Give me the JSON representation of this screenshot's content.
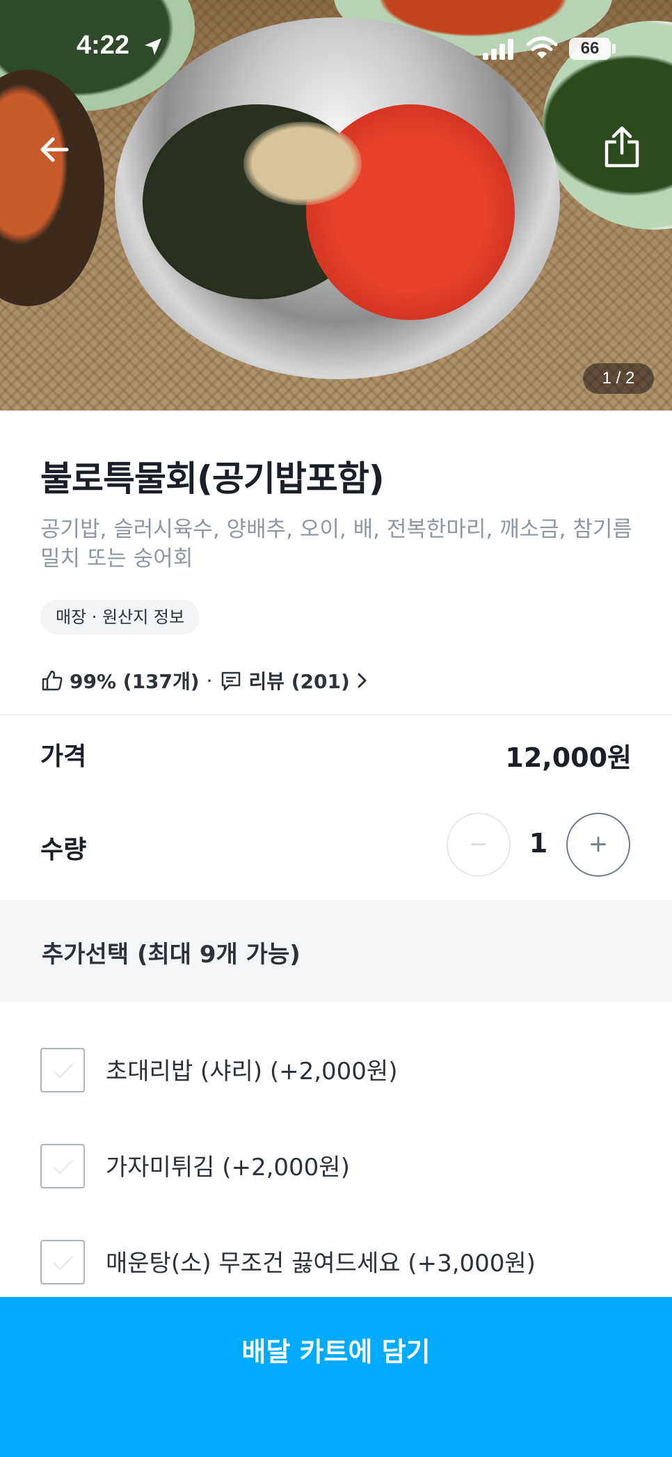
{
  "status_bar": {
    "time": "4:22",
    "battery": "66"
  },
  "hero": {
    "page_indicator": "1 / 2"
  },
  "product": {
    "title": "불로특물회(공기밥포함)",
    "description": "공기밥, 슬러시육수, 양배추, 오이, 배, 전복한마리, 깨소금, 참기름 밀치 또는 숭어회",
    "origin_chip": "매장 · 원산지 정보",
    "rating_text": "99% (137개)",
    "rating_separator": "·",
    "review_text": "리뷰 (201)"
  },
  "price": {
    "label": "가격",
    "value": "12,000원"
  },
  "quantity": {
    "label": "수량",
    "value": "1",
    "minus": "−",
    "plus": "+"
  },
  "options": {
    "header": "추가선택 (최대 9개 가능)",
    "items": [
      {
        "label": "초대리밥 (샤리) (+2,000원)",
        "checked": false
      },
      {
        "label": "가자미튀김 (+2,000원)",
        "checked": false
      },
      {
        "label": "매운탕(소) 무조건 끓여드세요 (+3,000원)",
        "checked": false
      }
    ]
  },
  "cta": {
    "label": "배달 카트에 담기",
    "color": "#00aaff"
  }
}
